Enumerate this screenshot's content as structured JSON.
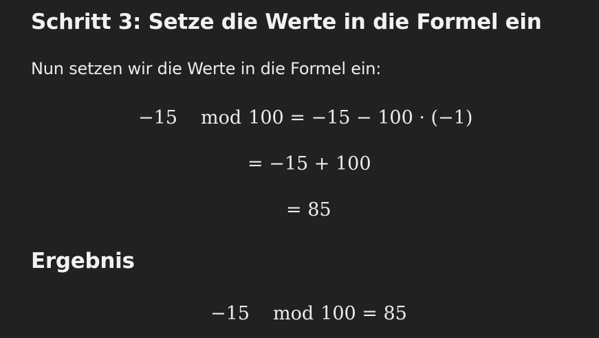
{
  "step": {
    "heading": "Schritt 3: Setze die Werte in die Formel ein",
    "intro": "Nun setzen wir die Werte in die Formel ein:",
    "equation_line1": {
      "lhs_number": "−15",
      "mod_word": "mod",
      "rhs": "100 = −15 − 100 · (−1)"
    },
    "equation_line2": "= −15 + 100",
    "equation_line3": "= 85"
  },
  "result": {
    "heading": "Ergebnis",
    "equation": {
      "lhs_number": "−15",
      "mod_word": "mod",
      "rhs": "100 = 85"
    }
  }
}
